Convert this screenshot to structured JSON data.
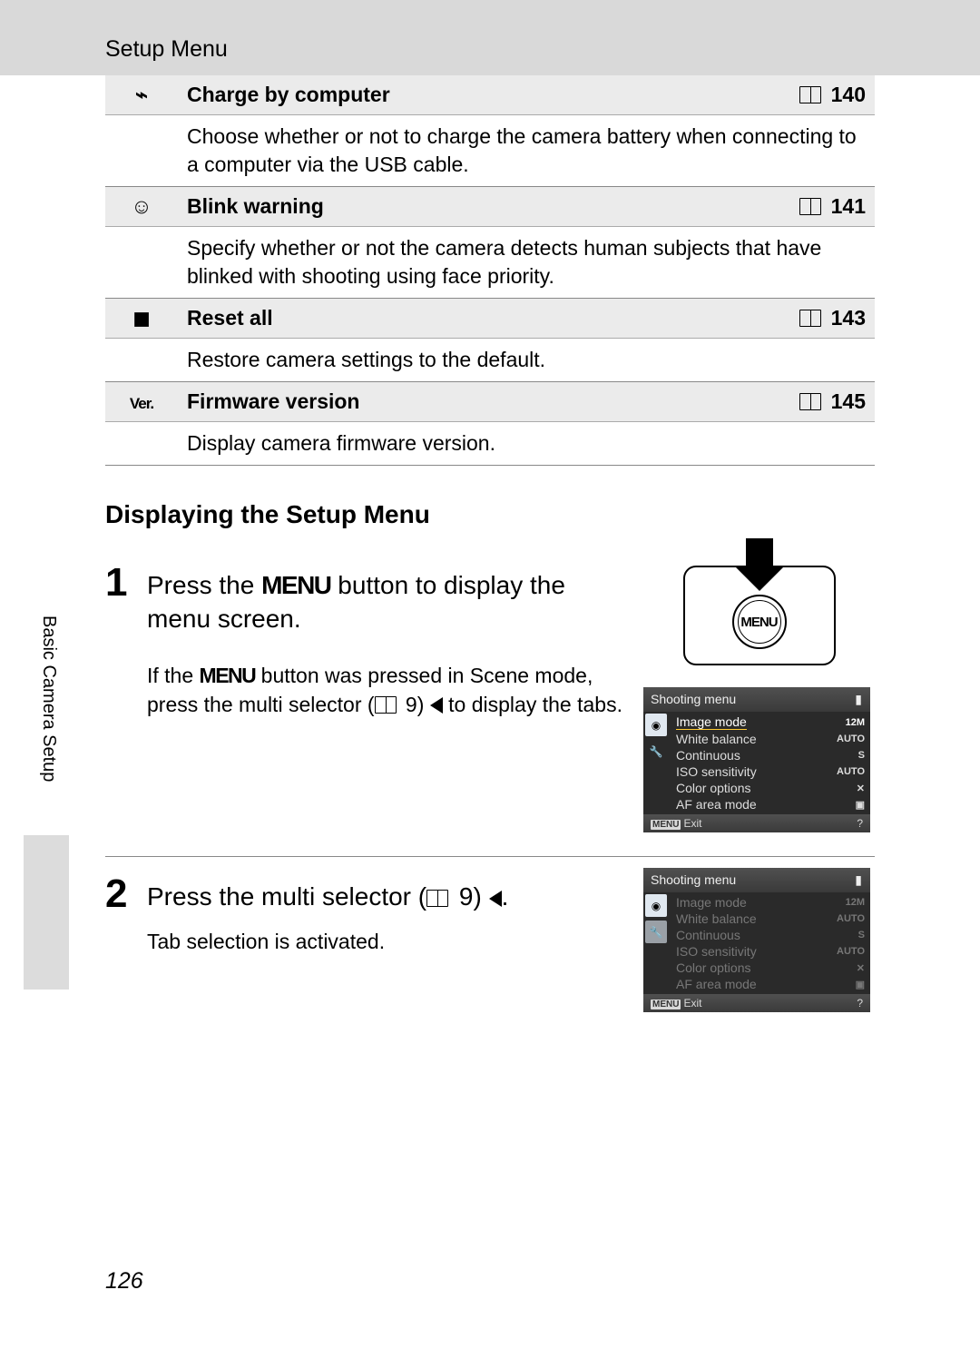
{
  "header": {
    "title": "Setup Menu"
  },
  "menu_rows": [
    {
      "icon_label": "charge-by-computer-icon",
      "title": "Charge by computer",
      "page": "140",
      "desc": "Choose whether or not to charge the camera battery when connecting to a computer via the USB cable."
    },
    {
      "icon_label": "blink-warning-icon",
      "title": "Blink warning",
      "page": "141",
      "desc": "Specify whether or not the camera detects human subjects that have blinked with shooting using face priority."
    },
    {
      "icon_label": "reset-all-icon",
      "title": "Reset all",
      "page": "143",
      "desc": "Restore camera settings to the default."
    },
    {
      "icon_label": "firmware-version-icon",
      "icon_text": "Ver.",
      "title": "Firmware version",
      "page": "145",
      "desc": "Display camera firmware version."
    }
  ],
  "section_heading": "Displaying the Setup Menu",
  "steps": {
    "one": {
      "num": "1",
      "title_a": "Press the ",
      "title_menu": "MENU",
      "title_b": " button to display the menu screen.",
      "sub_a": "If the ",
      "sub_b": " button was pressed in Scene mode, press the multi selector (",
      "sub_pageref": "9",
      "sub_c": ") ",
      "sub_d": " to display the tabs.",
      "illus_button": "MENU"
    },
    "two": {
      "num": "2",
      "title_a": "Press the multi selector (",
      "title_pageref": "9",
      "title_b": ") ",
      "sub": "Tab selection is activated."
    }
  },
  "lcd": {
    "title": "Shooting menu",
    "items": [
      {
        "name": "Image mode",
        "value": "12M"
      },
      {
        "name": "White balance",
        "value": "AUTO"
      },
      {
        "name": "Continuous",
        "value": "S"
      },
      {
        "name": "ISO sensitivity",
        "value": "AUTO"
      },
      {
        "name": "Color options",
        "value": "✕"
      },
      {
        "name": "AF area mode",
        "value": "▣"
      }
    ],
    "foot": "Exit",
    "foot_menu": "MENU"
  },
  "side_tab": "Basic Camera Setup",
  "page_number": "126"
}
